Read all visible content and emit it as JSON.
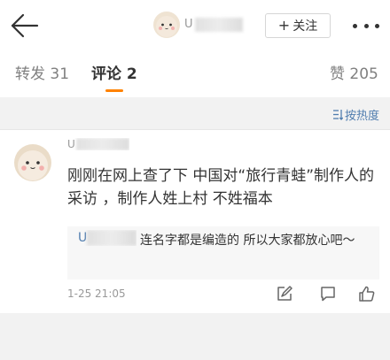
{
  "header": {
    "username": "U",
    "follow_label": "关注",
    "follow_plus": "+"
  },
  "tabs": [
    {
      "label": "转发 31"
    },
    {
      "label": "评论 2"
    },
    {
      "label": "赞 205"
    }
  ],
  "sort": {
    "label": "按热度"
  },
  "comment": {
    "username": "U",
    "text": "刚刚在网上查了下 中国对“旅行青蛙”制作人的采访 ，制作人姓上村  不姓福本",
    "reply": {
      "username": "U",
      "text": "连名字都是编造的 所以大家都放心吧～"
    },
    "time": "1-25 21:05"
  },
  "colors": {
    "accent": "#ff8200",
    "link": "#507daf",
    "text": "#333333",
    "muted": "#999999"
  },
  "icons": [
    "back-arrow-icon",
    "more-dots-icon",
    "sort-icon",
    "repost-icon",
    "comment-icon",
    "like-icon"
  ]
}
